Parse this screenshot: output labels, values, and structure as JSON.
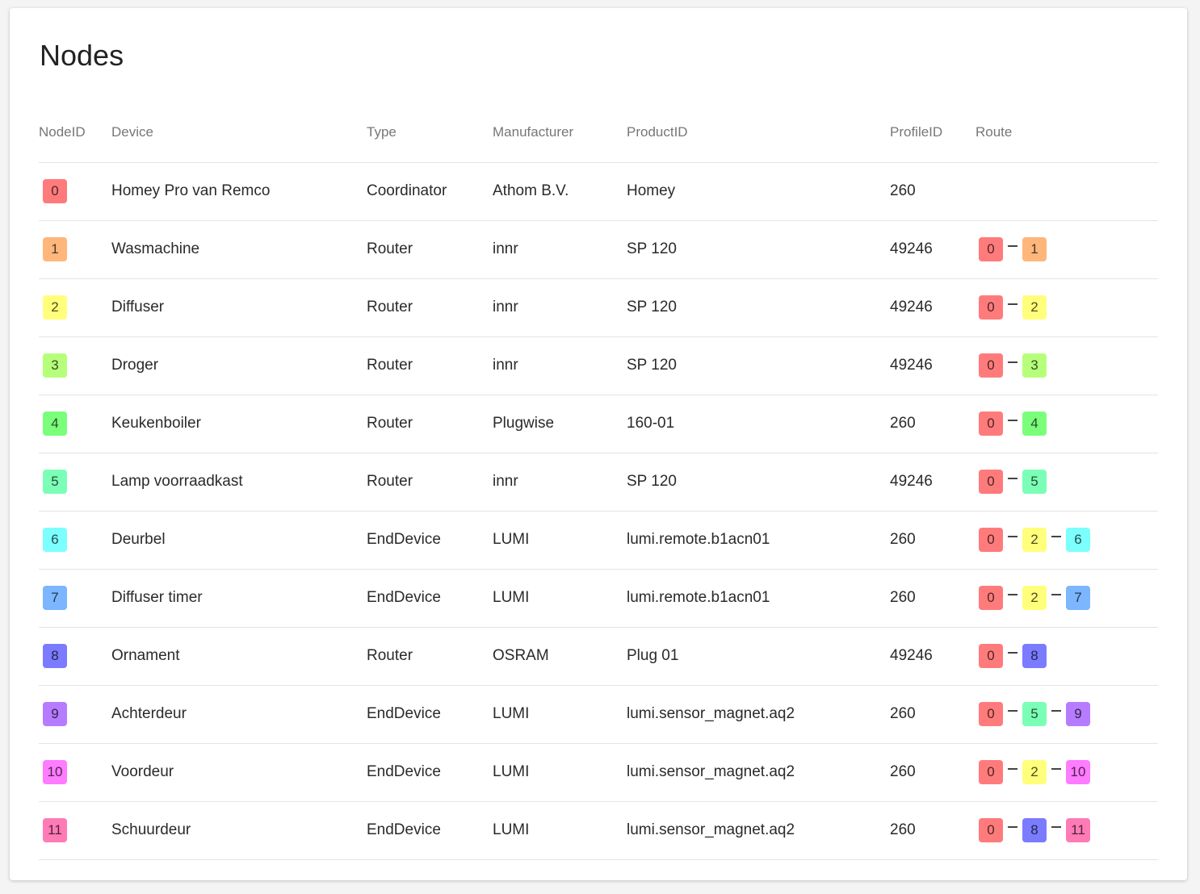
{
  "title": "Nodes",
  "headers": [
    "NodeID",
    "Device",
    "Type",
    "Manufacturer",
    "ProductID",
    "ProfileID",
    "Route"
  ],
  "node_colors": {
    "0": "#ff7b7b",
    "1": "#ffb67b",
    "2": "#ffff7b",
    "3": "#b6ff7b",
    "4": "#7bff7b",
    "5": "#7bffb6",
    "6": "#7bffff",
    "7": "#7bb6ff",
    "8": "#7b7bff",
    "9": "#b67bff",
    "10": "#ff7bff",
    "11": "#ff7bb6"
  },
  "rows": [
    {
      "id": "0",
      "device": "Homey Pro van Remco",
      "type": "Coordinator",
      "manufacturer": "Athom B.V.",
      "product": "Homey",
      "profile": "260",
      "route": []
    },
    {
      "id": "1",
      "device": "Wasmachine",
      "type": "Router",
      "manufacturer": "innr",
      "product": "SP 120",
      "profile": "49246",
      "route": [
        "0",
        "1"
      ]
    },
    {
      "id": "2",
      "device": "Diffuser",
      "type": "Router",
      "manufacturer": "innr",
      "product": "SP 120",
      "profile": "49246",
      "route": [
        "0",
        "2"
      ]
    },
    {
      "id": "3",
      "device": "Droger",
      "type": "Router",
      "manufacturer": "innr",
      "product": "SP 120",
      "profile": "49246",
      "route": [
        "0",
        "3"
      ]
    },
    {
      "id": "4",
      "device": "Keukenboiler",
      "type": "Router",
      "manufacturer": "Plugwise",
      "product": "160-01",
      "profile": "260",
      "route": [
        "0",
        "4"
      ]
    },
    {
      "id": "5",
      "device": "Lamp voorraadkast",
      "type": "Router",
      "manufacturer": "innr",
      "product": "SP 120",
      "profile": "49246",
      "route": [
        "0",
        "5"
      ]
    },
    {
      "id": "6",
      "device": "Deurbel",
      "type": "EndDevice",
      "manufacturer": "LUMI",
      "product": "lumi.remote.b1acn01",
      "profile": "260",
      "route": [
        "0",
        "2",
        "6"
      ]
    },
    {
      "id": "7",
      "device": "Diffuser timer",
      "type": "EndDevice",
      "manufacturer": "LUMI",
      "product": "lumi.remote.b1acn01",
      "profile": "260",
      "route": [
        "0",
        "2",
        "7"
      ]
    },
    {
      "id": "8",
      "device": "Ornament",
      "type": "Router",
      "manufacturer": "OSRAM",
      "product": "Plug 01",
      "profile": "49246",
      "route": [
        "0",
        "8"
      ]
    },
    {
      "id": "9",
      "device": "Achterdeur",
      "type": "EndDevice",
      "manufacturer": "LUMI",
      "product": "lumi.sensor_magnet.aq2",
      "profile": "260",
      "route": [
        "0",
        "5",
        "9"
      ]
    },
    {
      "id": "10",
      "device": "Voordeur",
      "type": "EndDevice",
      "manufacturer": "LUMI",
      "product": "lumi.sensor_magnet.aq2",
      "profile": "260",
      "route": [
        "0",
        "2",
        "10"
      ]
    },
    {
      "id": "11",
      "device": "Schuurdeur",
      "type": "EndDevice",
      "manufacturer": "LUMI",
      "product": "lumi.sensor_magnet.aq2",
      "profile": "260",
      "route": [
        "0",
        "8",
        "11"
      ]
    }
  ]
}
